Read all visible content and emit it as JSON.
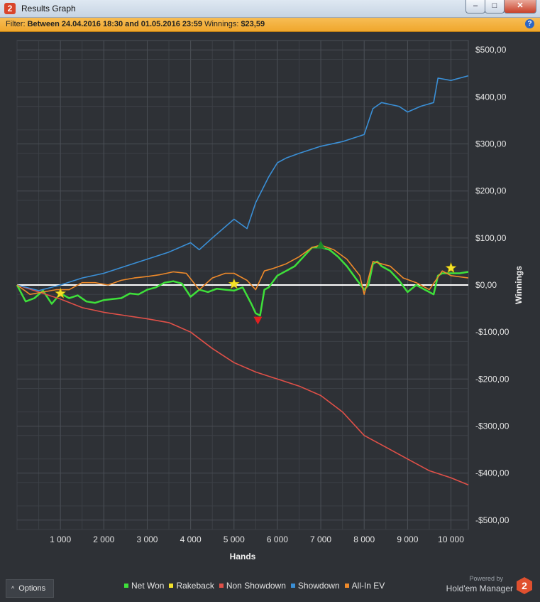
{
  "window": {
    "title": "Results Graph",
    "app_badge": "2",
    "min_symbol": "–",
    "max_symbol": "□",
    "close_symbol": "✕"
  },
  "filter": {
    "prefix": "Filter:",
    "range": "Between 24.04.2016 18:30 and 01.05.2016 23:59",
    "winnings_label": "Winnings:",
    "winnings_value": "$23,59",
    "help_symbol": "?"
  },
  "options": {
    "label": "Options",
    "chevron": "^"
  },
  "branding": {
    "powered_by": "Powered by",
    "name": "Hold'em Manager",
    "badge": "2",
    "logo_color": "#e0502f"
  },
  "chart_data": {
    "type": "line",
    "xlabel": "Hands",
    "ylabel": "Winnings",
    "xlim": [
      0,
      10400
    ],
    "ylim": [
      -520,
      520
    ],
    "x_ticks": [
      1000,
      2000,
      3000,
      4000,
      5000,
      6000,
      7000,
      8000,
      9000,
      10000
    ],
    "x_tick_labels": [
      "1 000",
      "2 000",
      "3 000",
      "4 000",
      "5 000",
      "6 000",
      "7 000",
      "8 000",
      "9 000",
      "10 000"
    ],
    "y_ticks": [
      500,
      400,
      300,
      200,
      100,
      0,
      -100,
      -200,
      -300,
      -400,
      -500
    ],
    "y_tick_labels": [
      "$500,00",
      "$400,00",
      "$300,00",
      "$200,00",
      "$100,00",
      "$0,00",
      "-$100,00",
      "-$200,00",
      "-$300,00",
      "-$400,00",
      "-$500,00"
    ],
    "grid": true,
    "legend_position": "bottom",
    "background": "#2e3136",
    "series": [
      {
        "name": "Net Won",
        "color": "#3ee03a",
        "x": [
          0,
          200,
          400,
          600,
          800,
          1000,
          1200,
          1400,
          1600,
          1800,
          2000,
          2200,
          2400,
          2600,
          2800,
          3000,
          3200,
          3400,
          3600,
          3800,
          4000,
          4200,
          4400,
          4600,
          4800,
          5000,
          5200,
          5400,
          5500,
          5600,
          5700,
          5800,
          6000,
          6200,
          6400,
          6600,
          6800,
          7000,
          7200,
          7400,
          7600,
          7800,
          8000,
          8100,
          8200,
          8300,
          8400,
          8600,
          8800,
          9000,
          9200,
          9400,
          9600,
          9700,
          9800,
          10000,
          10200,
          10400
        ],
        "y": [
          0,
          -35,
          -28,
          -12,
          -40,
          -18,
          -28,
          -22,
          -35,
          -38,
          -32,
          -30,
          -28,
          -18,
          -20,
          -10,
          -5,
          5,
          8,
          3,
          -25,
          -10,
          -15,
          -8,
          -10,
          -12,
          -5,
          -40,
          -60,
          -65,
          -10,
          -5,
          20,
          30,
          40,
          60,
          80,
          80,
          75,
          60,
          40,
          15,
          -10,
          0,
          45,
          50,
          40,
          30,
          10,
          -15,
          0,
          -10,
          -20,
          20,
          25,
          25,
          25,
          28
        ]
      },
      {
        "name": "Rakeback",
        "color": "#f4e22b",
        "x": [
          1000,
          5000,
          10000
        ],
        "y": [
          -18,
          2,
          36
        ]
      },
      {
        "name": "Non Showdown",
        "color": "#e05048",
        "x": [
          0,
          500,
          1000,
          1500,
          2000,
          2500,
          3000,
          3500,
          4000,
          4500,
          5000,
          5500,
          6000,
          6500,
          7000,
          7500,
          8000,
          8500,
          9000,
          9500,
          10000,
          10400
        ],
        "y": [
          0,
          -15,
          -30,
          -48,
          -58,
          -65,
          -72,
          -80,
          -100,
          -135,
          -165,
          -185,
          -200,
          -215,
          -235,
          -270,
          -320,
          -345,
          -370,
          -395,
          -410,
          -425
        ]
      },
      {
        "name": "Showdown",
        "color": "#3a8fd6",
        "x": [
          0,
          500,
          1000,
          1500,
          2000,
          2500,
          3000,
          3500,
          4000,
          4200,
          4500,
          5000,
          5300,
          5500,
          5800,
          6000,
          6200,
          6500,
          7000,
          7500,
          8000,
          8200,
          8400,
          8800,
          9000,
          9300,
          9600,
          9700,
          10000,
          10400
        ],
        "y": [
          0,
          -12,
          0,
          15,
          25,
          40,
          55,
          70,
          90,
          75,
          100,
          140,
          120,
          175,
          230,
          260,
          270,
          280,
          295,
          305,
          320,
          375,
          388,
          380,
          368,
          380,
          388,
          440,
          435,
          445
        ]
      },
      {
        "name": "All-In EV",
        "color": "#ef8a2a",
        "x": [
          0,
          300,
          600,
          900,
          1200,
          1500,
          1800,
          2100,
          2400,
          2700,
          3000,
          3300,
          3600,
          3900,
          4200,
          4500,
          4800,
          5000,
          5300,
          5500,
          5700,
          5900,
          6200,
          6500,
          6800,
          7000,
          7300,
          7600,
          7900,
          8000,
          8200,
          8400,
          8600,
          8900,
          9200,
          9500,
          9800,
          10000,
          10400
        ],
        "y": [
          0,
          -20,
          -15,
          -10,
          -10,
          5,
          5,
          0,
          10,
          15,
          18,
          22,
          28,
          25,
          -10,
          15,
          25,
          25,
          10,
          -10,
          30,
          35,
          45,
          60,
          80,
          85,
          75,
          55,
          20,
          -20,
          50,
          45,
          40,
          15,
          5,
          -10,
          30,
          20,
          15
        ]
      }
    ],
    "markers": [
      {
        "type": "star",
        "series": "Rakeback",
        "x": 1000,
        "y": -18,
        "color": "#f4e22b"
      },
      {
        "type": "star",
        "series": "Rakeback",
        "x": 5000,
        "y": 2,
        "color": "#f4e22b"
      },
      {
        "type": "star",
        "series": "Rakeback",
        "x": 10000,
        "y": 36,
        "color": "#f4e22b"
      },
      {
        "type": "triangle-down",
        "x": 5550,
        "y": -75,
        "color": "#e02020"
      },
      {
        "type": "triangle-up",
        "x": 7000,
        "y": 85,
        "color": "#1f8a2a"
      }
    ]
  }
}
